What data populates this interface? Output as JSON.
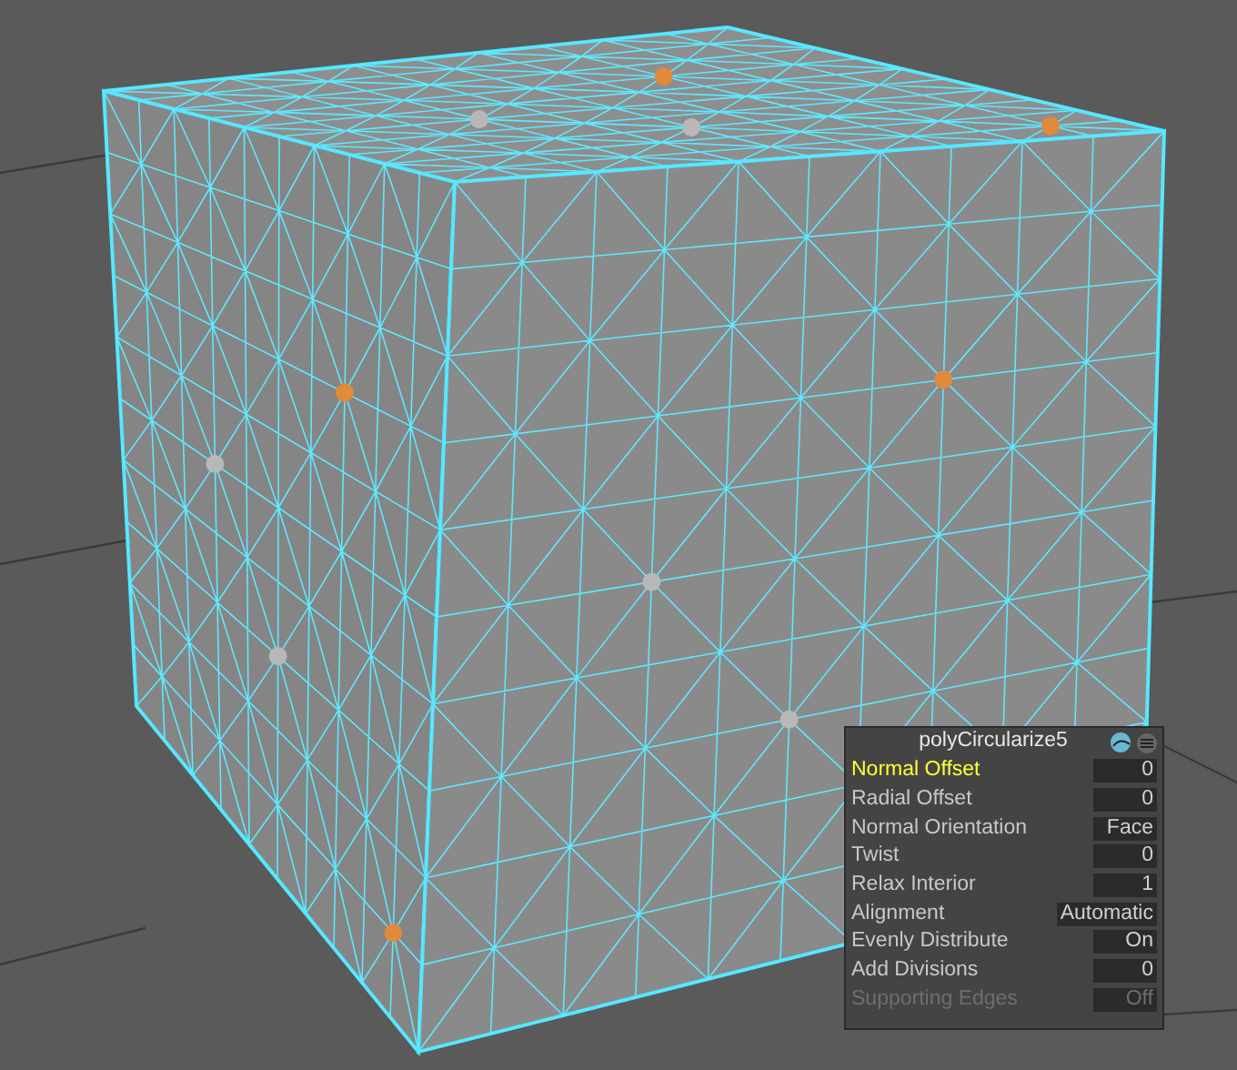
{
  "panel": {
    "title": "polyCircularize5",
    "rows": [
      {
        "label": "Normal Offset",
        "value": "0",
        "selected": true,
        "disabled": false
      },
      {
        "label": "Radial Offset",
        "value": "0",
        "selected": false,
        "disabled": false
      },
      {
        "label": "Normal Orientation",
        "value": "Face",
        "selected": false,
        "disabled": false
      },
      {
        "label": "Twist",
        "value": "0",
        "selected": false,
        "disabled": false
      },
      {
        "label": "Relax Interior",
        "value": "1",
        "selected": false,
        "disabled": false
      },
      {
        "label": "Alignment",
        "value": "Automatic",
        "selected": false,
        "disabled": false
      },
      {
        "label": "Evenly Distribute",
        "value": "On",
        "selected": false,
        "disabled": false
      },
      {
        "label": "Add Divisions",
        "value": "0",
        "selected": false,
        "disabled": false
      },
      {
        "label": "Supporting Edges",
        "value": "Off",
        "selected": false,
        "disabled": true
      }
    ]
  }
}
